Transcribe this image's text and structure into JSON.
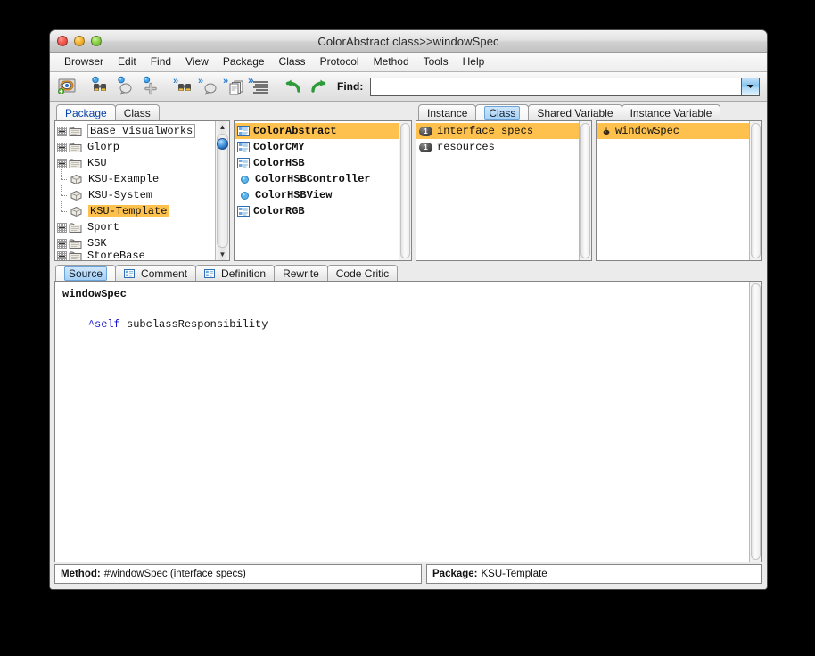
{
  "window": {
    "title": "ColorAbstract class>>windowSpec",
    "controls": {
      "close": "close",
      "minimize": "minimize",
      "zoom": "zoom"
    }
  },
  "menubar": {
    "items": [
      {
        "label": "Browser"
      },
      {
        "label": "Edit"
      },
      {
        "label": "Find"
      },
      {
        "label": "View"
      },
      {
        "label": "Package"
      },
      {
        "label": "Class"
      },
      {
        "label": "Protocol"
      },
      {
        "label": "Method"
      },
      {
        "label": "Tools"
      },
      {
        "label": "Help"
      }
    ]
  },
  "toolbar": {
    "buttons": [
      {
        "name": "browse-icon",
        "title": "Browse"
      },
      {
        "name": "find-senders-icon",
        "title": "Senders"
      },
      {
        "name": "find-implementors-icon",
        "title": "Implementors"
      },
      {
        "name": "add-icon",
        "title": "Add"
      },
      {
        "name": "next-senders-icon",
        "title": "Next Senders"
      },
      {
        "name": "next-implementors-icon",
        "title": "Next Implementors"
      },
      {
        "name": "copy-icon",
        "title": "Copy"
      },
      {
        "name": "format-icon",
        "title": "Format"
      },
      {
        "name": "undo-icon",
        "title": "Undo"
      },
      {
        "name": "redo-icon",
        "title": "Redo"
      }
    ],
    "find_label": "Find:",
    "find_value": "",
    "find_placeholder": "",
    "find_dropdown_icon": "chevron-down-icon"
  },
  "left_panel": {
    "tabs": [
      {
        "label": "Package",
        "active": true
      },
      {
        "label": "Class",
        "active": false
      }
    ],
    "tree": [
      {
        "label": "Base VisualWorks",
        "depth": 0,
        "expander": "plus",
        "icon": "package-icon",
        "style": "boxed"
      },
      {
        "label": "Glorp",
        "depth": 0,
        "expander": "plus",
        "icon": "package-icon",
        "style": "plain"
      },
      {
        "label": "KSU",
        "depth": 0,
        "expander": "minus",
        "icon": "package-icon",
        "style": "plain"
      },
      {
        "label": "KSU-Example",
        "depth": 1,
        "expander": "none",
        "icon": "bundle-icon",
        "style": "plain"
      },
      {
        "label": "KSU-System",
        "depth": 1,
        "expander": "none",
        "icon": "bundle-icon",
        "style": "plain"
      },
      {
        "label": "KSU-Template",
        "depth": 1,
        "expander": "none",
        "icon": "bundle-icon",
        "style": "highlight"
      },
      {
        "label": "Sport",
        "depth": 0,
        "expander": "plus",
        "icon": "package-icon",
        "style": "plain"
      },
      {
        "label": "SSK",
        "depth": 0,
        "expander": "plus",
        "icon": "package-icon",
        "style": "plain"
      },
      {
        "label": "StoreBase",
        "depth": 0,
        "expander": "plus",
        "icon": "package-icon",
        "style": "plain"
      }
    ],
    "scrollbar": {
      "up": "scroll-up-arrow-icon",
      "down": "scroll-down-arrow-icon"
    }
  },
  "class_panel": {
    "items": [
      {
        "label": "ColorAbstract",
        "icon": "class-icon",
        "selected": true
      },
      {
        "label": "ColorCMY",
        "icon": "class-icon",
        "selected": false
      },
      {
        "label": "ColorHSB",
        "icon": "class-icon",
        "selected": false
      },
      {
        "label": "ColorHSBController",
        "icon": "dot-icon",
        "selected": false
      },
      {
        "label": "ColorHSBView",
        "icon": "dot-icon",
        "selected": false
      },
      {
        "label": "ColorRGB",
        "icon": "class-icon",
        "selected": false
      }
    ]
  },
  "protocol_panel": {
    "tabs": [
      {
        "label": "Instance",
        "active": false
      },
      {
        "label": "Class",
        "active": true
      },
      {
        "label": "Shared Variable",
        "active": false
      },
      {
        "label": "Instance Variable",
        "active": false
      }
    ],
    "items": [
      {
        "label": "interface specs",
        "badge": "1",
        "selected": true
      },
      {
        "label": "resources",
        "badge": "1",
        "selected": false
      }
    ]
  },
  "method_panel": {
    "items": [
      {
        "label": "windowSpec",
        "icon": "method-pin-icon",
        "selected": true
      }
    ]
  },
  "editor": {
    "tabs": [
      {
        "label": "Source",
        "active": true,
        "icon": null
      },
      {
        "label": "Comment",
        "active": false,
        "icon": "doc-icon"
      },
      {
        "label": "Definition",
        "active": false,
        "icon": "doc-icon"
      },
      {
        "label": "Rewrite",
        "active": false,
        "icon": null
      },
      {
        "label": "Code Critic",
        "active": false,
        "icon": null
      }
    ],
    "code_lines": [
      {
        "type": "signature",
        "text": "windowSpec"
      },
      {
        "type": "blank",
        "text": ""
      },
      {
        "type": "blank",
        "text": ""
      },
      {
        "type": "statement",
        "indent": "    ",
        "caret": "^",
        "keyword": "self",
        "rest": " subclassResponsibility"
      }
    ]
  },
  "statusbar": {
    "method_key": "Method:",
    "method_value": "#windowSpec (interface specs)",
    "package_key": "Package:",
    "package_value": "KSU-Template"
  },
  "colors": {
    "selection": "#ffc14d",
    "window_bg": "#ebebeb",
    "tab_active_text": "#0a43a8",
    "keyword": "#1414cc"
  }
}
